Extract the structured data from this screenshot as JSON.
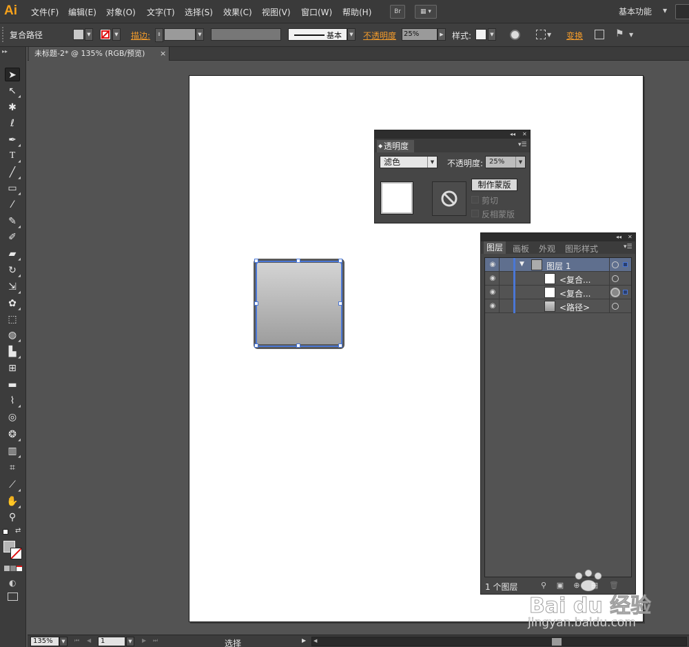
{
  "app": {
    "logo": "Ai"
  },
  "menu": {
    "items": [
      "文件(F)",
      "编辑(E)",
      "对象(O)",
      "文字(T)",
      "选择(S)",
      "效果(C)",
      "视图(V)",
      "窗口(W)",
      "帮助(H)"
    ],
    "bridge_label": "Br",
    "workspace": "基本功能"
  },
  "control": {
    "object_type": "复合路径",
    "stroke_label": "描边:",
    "stroke_style": "基本",
    "opacity_label": "不透明度",
    "opacity_value": "25%",
    "style_label": "样式:",
    "transform_label": "变换"
  },
  "document": {
    "tab_title": "未标题-2* @ 135% (RGB/预览)",
    "close": "×"
  },
  "transparency_panel": {
    "tab": "透明度",
    "blend_mode": "滤色",
    "opacity_label": "不透明度:",
    "opacity_value": "25%",
    "make_mask": "制作蒙版",
    "clip": "剪切",
    "invert_mask": "反相蒙版"
  },
  "layers_panel": {
    "tabs": [
      "图层",
      "画板",
      "外观",
      "图形样式"
    ],
    "rows": [
      {
        "name": "图层 1",
        "kind": "layer"
      },
      {
        "name": "<复合...",
        "kind": "compound"
      },
      {
        "name": "<复合...",
        "kind": "compound"
      },
      {
        "name": "<路径>",
        "kind": "path"
      }
    ],
    "footer": "1 个图层"
  },
  "status": {
    "zoom": "135%",
    "page": "1",
    "text": "选择"
  },
  "watermark": {
    "logo": "Bai du 经验",
    "url": "jingyan.baidu.com"
  },
  "colors": {
    "accent": "#f7a21b",
    "selection": "#4a77d6",
    "panel": "#464646",
    "canvas": "#535353"
  }
}
